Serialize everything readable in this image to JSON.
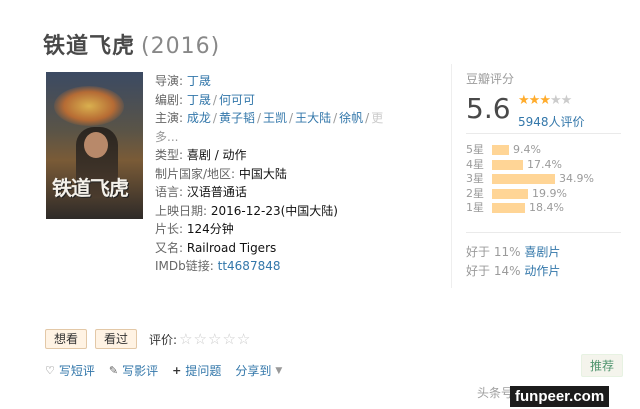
{
  "movie": {
    "title": "铁道飞虎",
    "year": "(2016)",
    "poster_title": "铁道飞虎"
  },
  "info": {
    "director_label": "导演:",
    "director": "丁晟",
    "writer_label": "编剧:",
    "writers": [
      "丁晟",
      "何可可"
    ],
    "cast_label": "主演:",
    "cast": [
      "成龙",
      "黄子韬",
      "王凯",
      "王大陆",
      "徐帆"
    ],
    "cast_more": "更",
    "cast_more2": "多...",
    "genre_label": "类型:",
    "genres": "喜剧 / 动作",
    "country_label": "制片国家/地区:",
    "country": "中国大陆",
    "language_label": "语言:",
    "language": "汉语普通话",
    "release_label": "上映日期:",
    "release": "2016-12-23(中国大陆)",
    "runtime_label": "片长:",
    "runtime": "124分钟",
    "aka_label": "又名:",
    "aka": "Railroad Tigers",
    "imdb_label": "IMDb链接:",
    "imdb": "tt4687848"
  },
  "rating": {
    "title": "豆瓣评分",
    "score": "5.6",
    "stars_filled": 3,
    "votes": "5948人评价",
    "breakdown": [
      {
        "label": "5星",
        "pct": "9.4%",
        "value": 9.4
      },
      {
        "label": "4星",
        "pct": "17.4%",
        "value": 17.4
      },
      {
        "label": "3星",
        "pct": "34.9%",
        "value": 34.9
      },
      {
        "label": "2星",
        "pct": "19.9%",
        "value": 19.9
      },
      {
        "label": "1星",
        "pct": "18.4%",
        "value": 18.4
      }
    ],
    "better1_prefix": "好于",
    "better1_pct": "11%",
    "better1_link": "喜剧片",
    "better2_prefix": "好于",
    "better2_pct": "14%",
    "better2_link": "动作片"
  },
  "actions": {
    "want": "想看",
    "seen": "看过",
    "rate_label": "评价:"
  },
  "links": {
    "short_review": "写短评",
    "review": "写影评",
    "question": "提问题",
    "share": "分享到"
  },
  "recommend": "推荐",
  "watermark": "头条号",
  "watermark_site": "funpeer.com",
  "colors": {
    "link": "#3377aa",
    "star": "#ffac2d",
    "bar": "#ffd596",
    "button_bg": "#fff3e4",
    "recommend_text": "#4f946e"
  }
}
